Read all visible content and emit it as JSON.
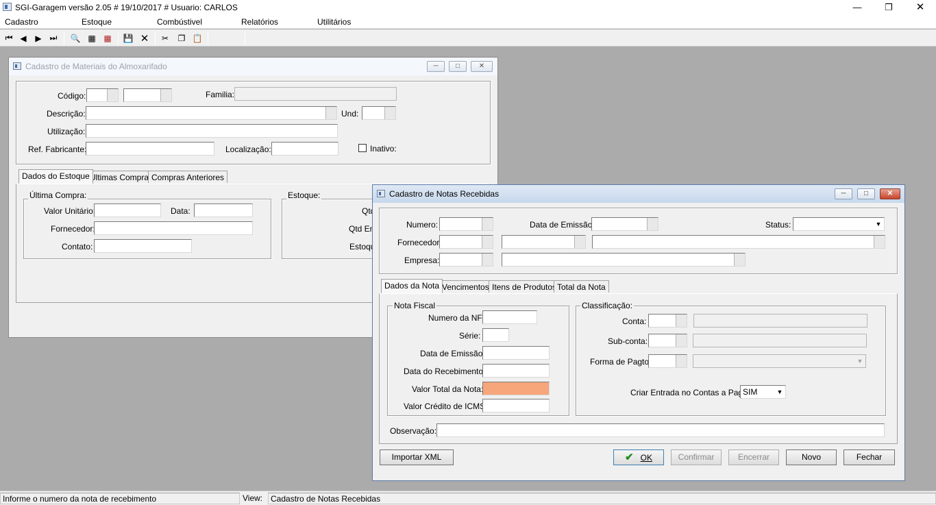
{
  "app": {
    "title": "SGI-Garagem versão 2.05 # 19/10/2017 # Usuario: CARLOS",
    "menu": [
      "Cadastro",
      "Estoque",
      "Combústivel",
      "Relatórios",
      "Utilitários"
    ]
  },
  "toolbar_icons": [
    "first-icon",
    "prev-icon",
    "next-icon",
    "last-icon",
    "search-icon",
    "grid-icon",
    "grid-red-icon",
    "save-icon",
    "delete-icon",
    "cut-icon",
    "copy-icon",
    "paste-icon"
  ],
  "win_materiais": {
    "title": "Cadastro de Materiais do Almoxarifado",
    "codigo_label": "Código:",
    "familia_label": "Familia:",
    "descricao_label": "Descrição:",
    "und_label": "Und:",
    "utilizacao_label": "Utilização:",
    "ref_label": "Ref. Fabricante:",
    "localizacao_label": "Localização:",
    "inativo_label": "Inativo:",
    "tabs": [
      "Dados do Estoque",
      "Ultimas Compras",
      "Compras Anteriores"
    ],
    "ultima_compra_label": "Última Compra:",
    "valor_unitario_label": "Valor Unitário:",
    "data_label": "Data:",
    "fornecedor_label": "Fornecedor:",
    "contato_label": "Contato:",
    "estoque_label": "Estoque:",
    "qtd_label": "Qtd",
    "qtd_em_label": "Qtd Em",
    "estoque_min_label": "Estoqu"
  },
  "win_notas": {
    "title": "Cadastro de Notas Recebidas",
    "numero_label": "Numero:",
    "data_emissao_label": "Data de Emissão:",
    "status_label": "Status:",
    "fornecedor_label": "Fornecedor",
    "empresa_label": "Empresa:",
    "tabs": [
      "Dados da Nota",
      "Vencimentos",
      "Itens de Produtos",
      "Total da Nota"
    ],
    "nota_fiscal_label": "Nota Fiscal",
    "numero_nf_label": "Numero da NF:",
    "serie_label": "Série:",
    "data_emissao2_label": "Data de Emissão:",
    "data_recebimento_label": "Data do Recebimento:",
    "valor_total_label": "Valor Total da Nota:",
    "valor_icms_label": "Valor Crédito de ICMS:",
    "classificacao_label": "Classificação:",
    "conta_label": "Conta:",
    "subconta_label": "Sub-conta:",
    "forma_pagto_label": "Forma de Pagto:",
    "criar_entrada_label": "Criar Entrada no Contas a Pagar",
    "criar_entrada_value": "SIM",
    "observacao_label": "Observação:",
    "buttons": {
      "importar": "Importar XML",
      "ok": "OK",
      "confirmar": "Confirmar",
      "encerrar": "Encerrar",
      "novo": "Novo",
      "fechar": "Fechar"
    },
    "colors": {
      "valor_total_bg": "#f7a57b"
    }
  },
  "status": {
    "message": "Informe o numero da nota de recebimento",
    "view_label": "View:",
    "view_value": "Cadastro de Notas Recebidas"
  }
}
